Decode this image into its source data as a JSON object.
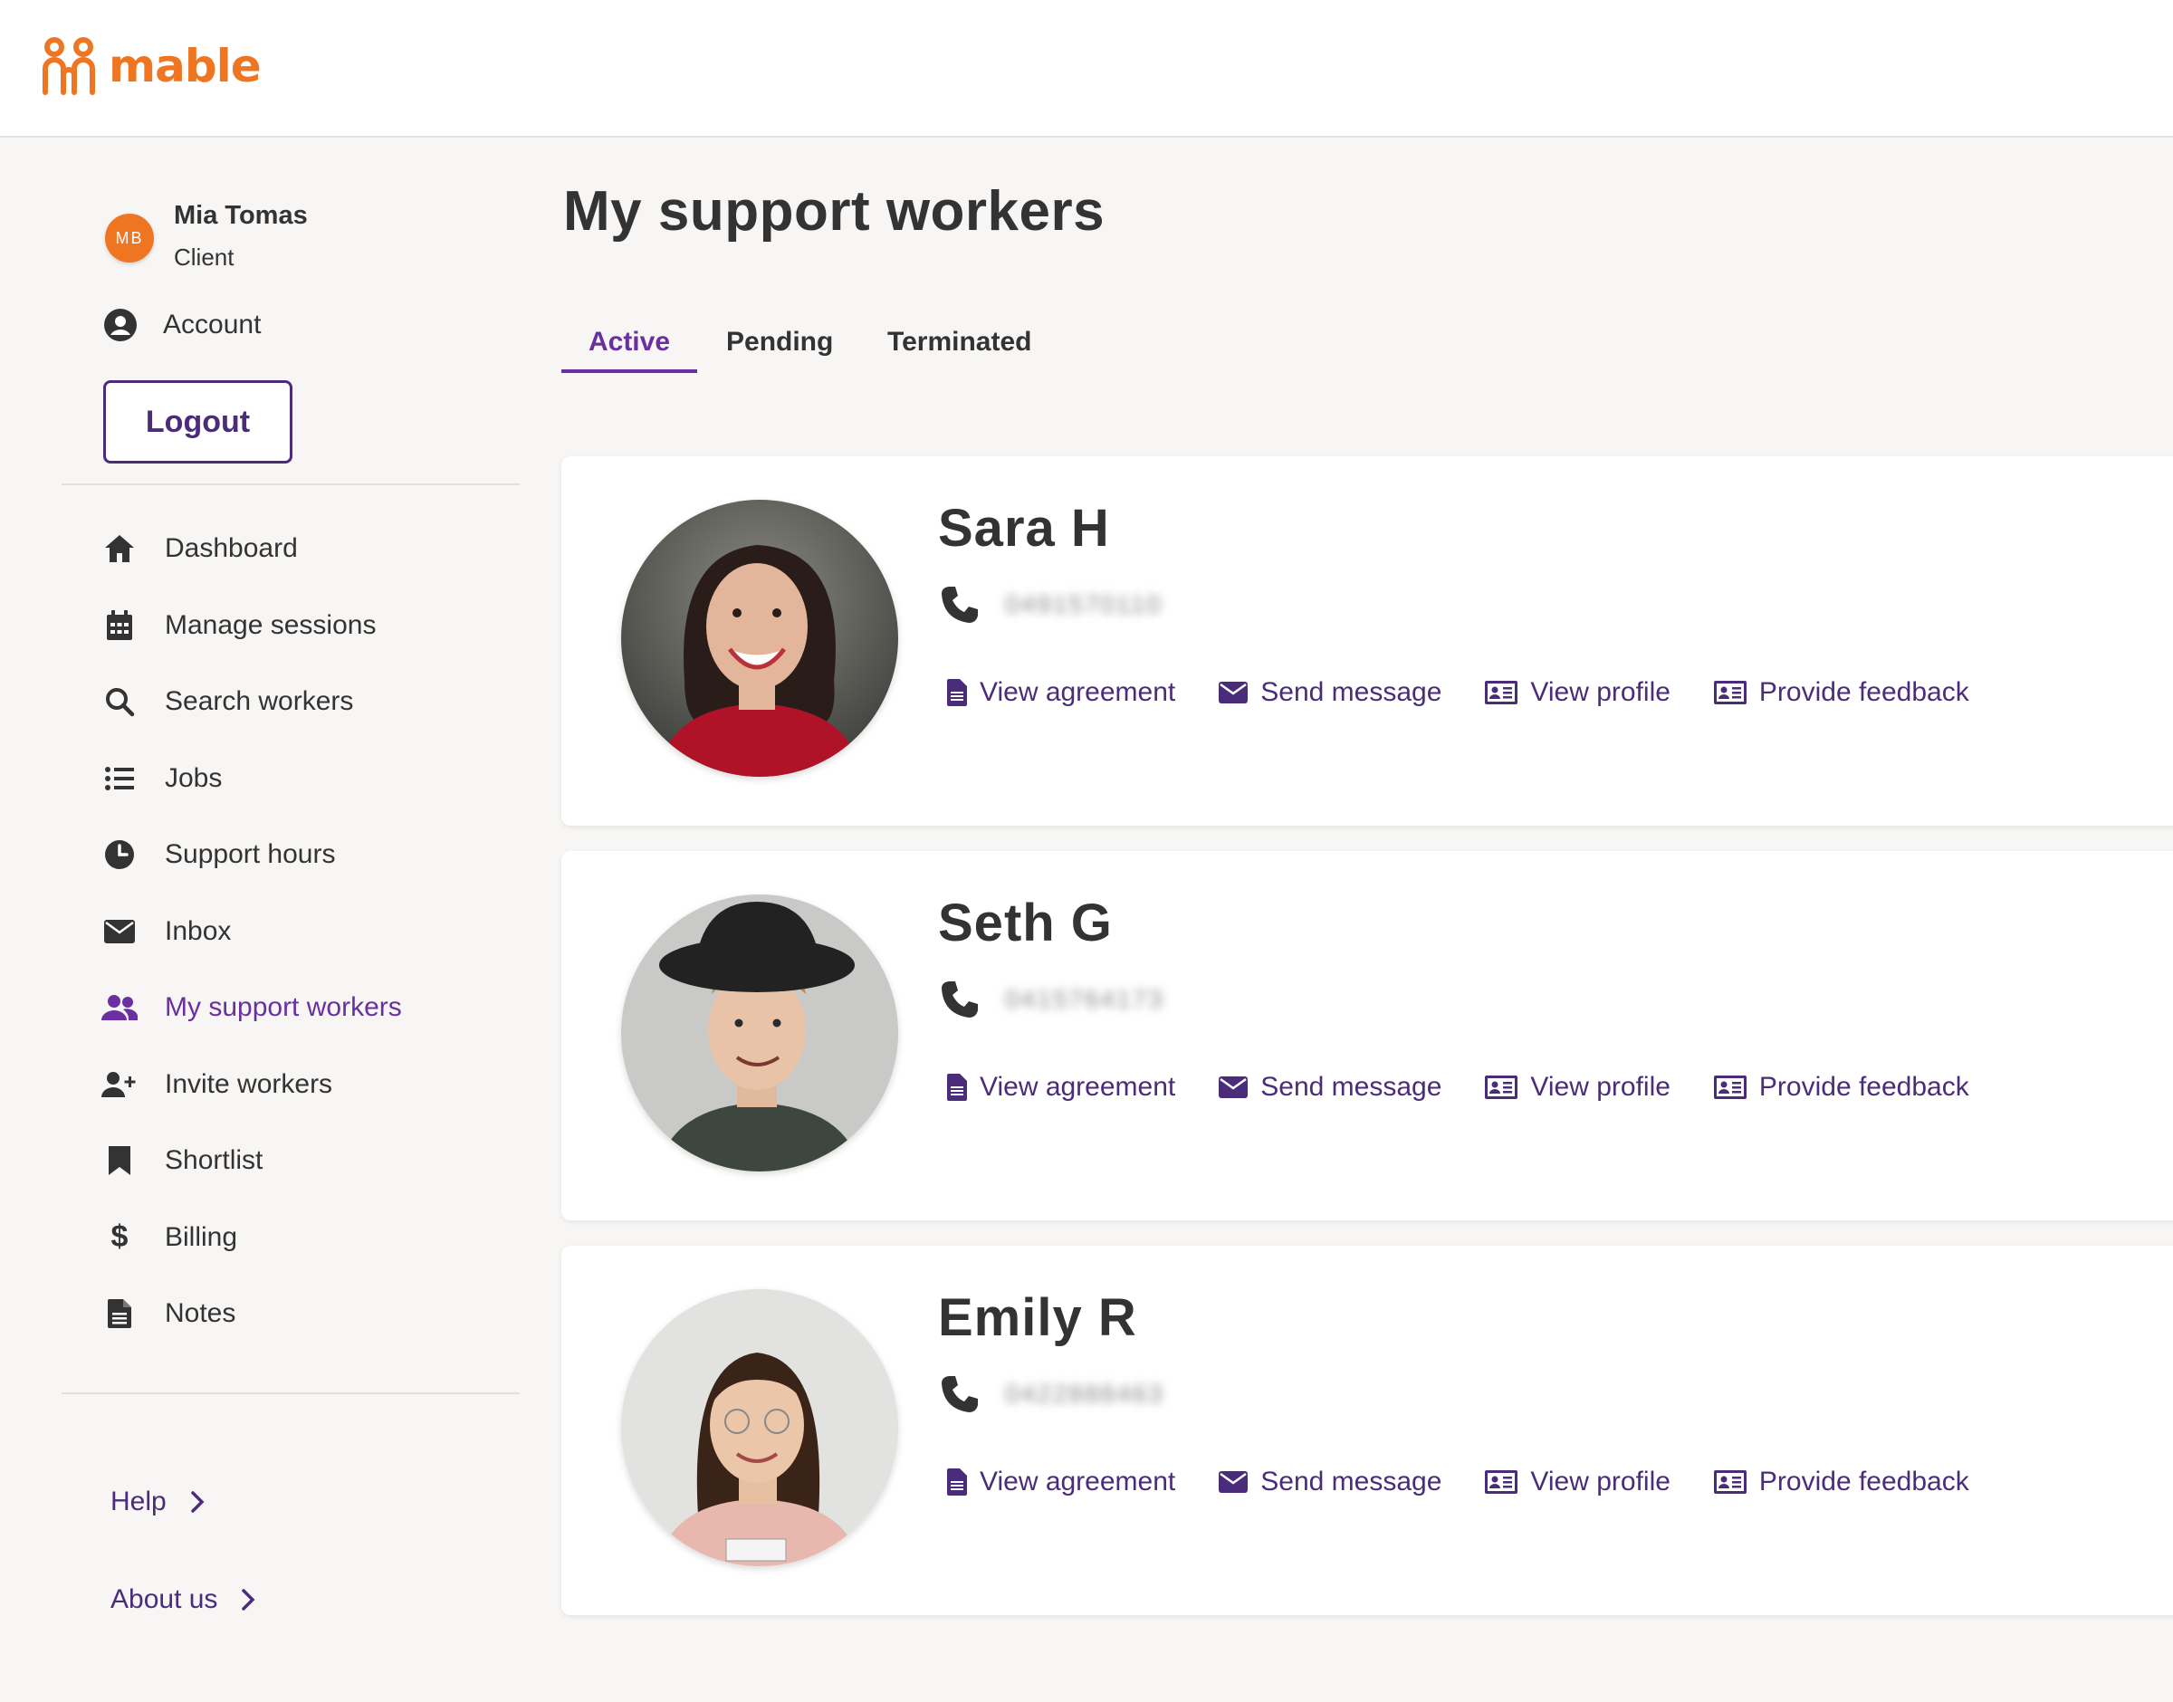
{
  "brand": {
    "name": "mable",
    "color": "#ee7623",
    "accent": "#6a2fa0",
    "dark_accent": "#4b2c7a"
  },
  "user": {
    "initials": "MB",
    "name": "Mia Tomas",
    "role": "Client"
  },
  "sidebar": {
    "account_label": "Account",
    "logout_label": "Logout",
    "items": [
      {
        "label": "Dashboard",
        "icon": "home-icon"
      },
      {
        "label": "Manage sessions",
        "icon": "calendar-icon"
      },
      {
        "label": "Search workers",
        "icon": "search-icon"
      },
      {
        "label": "Jobs",
        "icon": "list-icon"
      },
      {
        "label": "Support hours",
        "icon": "clock-icon"
      },
      {
        "label": "Inbox",
        "icon": "envelope-icon"
      },
      {
        "label": "My support workers",
        "icon": "users-icon",
        "active": true
      },
      {
        "label": "Invite workers",
        "icon": "user-plus-icon"
      },
      {
        "label": "Shortlist",
        "icon": "bookmark-icon"
      },
      {
        "label": "Billing",
        "icon": "dollar-icon"
      },
      {
        "label": "Notes",
        "icon": "file-icon"
      }
    ],
    "footer": [
      {
        "label": "Help",
        "icon": "chevron-right-icon"
      },
      {
        "label": "About us",
        "icon": "chevron-right-icon"
      }
    ]
  },
  "main": {
    "title": "My support workers",
    "tabs": [
      {
        "label": "Active",
        "active": true
      },
      {
        "label": "Pending"
      },
      {
        "label": "Terminated"
      }
    ],
    "workers": [
      {
        "name": "Sara H",
        "phone": "0491570110"
      },
      {
        "name": "Seth G",
        "phone": "0415764173"
      },
      {
        "name": "Emily R",
        "phone": "0422888463"
      }
    ],
    "actions": {
      "view_agreement": "View agreement",
      "send_message": "Send message",
      "view_profile": "View profile",
      "provide_feedback": "Provide feedback"
    }
  }
}
